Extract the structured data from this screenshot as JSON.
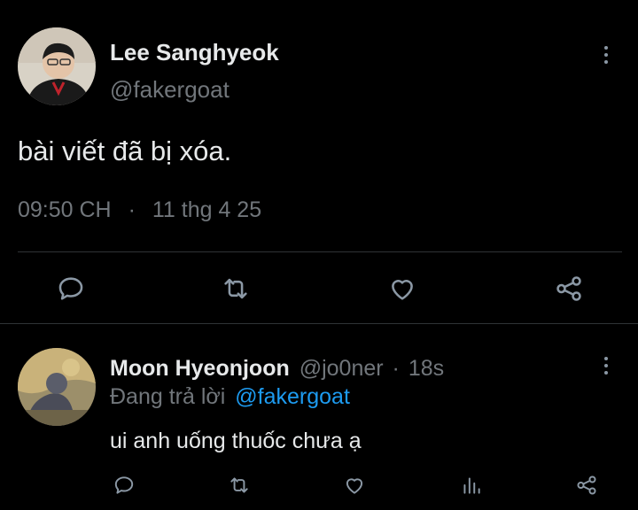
{
  "main_tweet": {
    "display_name": "Lee Sanghyeok",
    "handle": "@fakergoat",
    "text": "bài viết đã bị xóa.",
    "time": "09:50 CH",
    "separator": "·",
    "date": "11 thg 4 25"
  },
  "reply": {
    "display_name": "Moon Hyeonjoon",
    "handle": "@jo0ner",
    "separator": "·",
    "age": "18s",
    "replying_prefix": "Đang trả lời",
    "replying_to": "@fakergoat",
    "text": "ui anh uống thuốc chưa ạ"
  },
  "icons": {
    "reply": "reply-icon",
    "retweet": "retweet-icon",
    "like": "heart-icon",
    "analytics": "analytics-icon",
    "share": "share-icon",
    "more": "more-vertical-icon"
  },
  "colors": {
    "background": "#000000",
    "text": "#e7e9ea",
    "muted": "#71767b",
    "link": "#1d9bf0",
    "divider": "#2f3336"
  }
}
